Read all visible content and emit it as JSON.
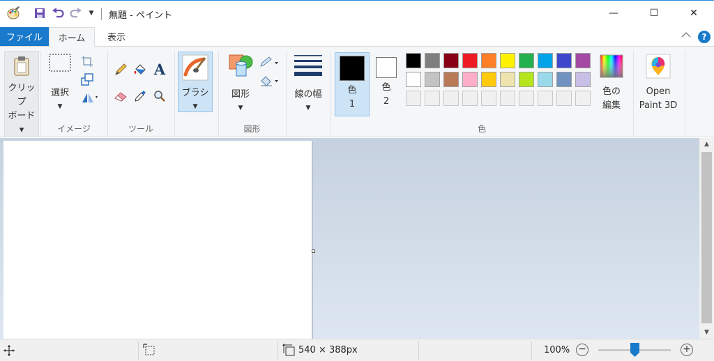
{
  "window": {
    "title": "無題 - ペイント",
    "min_glyph": "—",
    "max_glyph": "☐",
    "close_glyph": "✕"
  },
  "quick_access": {
    "customize_glyph": "▼"
  },
  "tabs": {
    "file": "ファイル",
    "home": "ホーム",
    "view": "表示"
  },
  "ribbon": {
    "clipboard": {
      "label_line1": "クリップ",
      "label_line2": "ボード"
    },
    "image": {
      "select_label": "選択",
      "group_label": "イメージ"
    },
    "tools": {
      "group_label": "ツール"
    },
    "brushes": {
      "label": "ブラシ"
    },
    "shapes": {
      "label": "図形",
      "group_label": "図形"
    },
    "size": {
      "label": "線の幅"
    },
    "colors": {
      "color1_label": "色",
      "color1_num": "1",
      "color1_value": "#000000",
      "color2_label": "色",
      "color2_num": "2",
      "color2_value": "#ffffff",
      "edit_line1": "色の",
      "edit_line2": "編集",
      "group_label": "色",
      "palette": [
        "#000000",
        "#7f7f7f",
        "#880015",
        "#ed1c24",
        "#ff7f27",
        "#fff200",
        "#22b14c",
        "#00a2e8",
        "#3f48cc",
        "#a349a4",
        "#ffffff",
        "#c3c3c3",
        "#b97a57",
        "#ffaec9",
        "#ffc90e",
        "#efe4b0",
        "#b5e61d",
        "#99d9ea",
        "#7092be",
        "#c8bfe7",
        "#f0f0f0",
        "#f0f0f0",
        "#f0f0f0",
        "#f0f0f0",
        "#f0f0f0",
        "#f0f0f0",
        "#f0f0f0",
        "#f0f0f0",
        "#f0f0f0",
        "#f0f0f0"
      ]
    },
    "paint3d": {
      "line1": "Open",
      "line2": "Paint 3D"
    }
  },
  "status": {
    "canvas_size": "540 × 388px",
    "zoom": "100%",
    "zoom_level_fraction": 0.5
  }
}
